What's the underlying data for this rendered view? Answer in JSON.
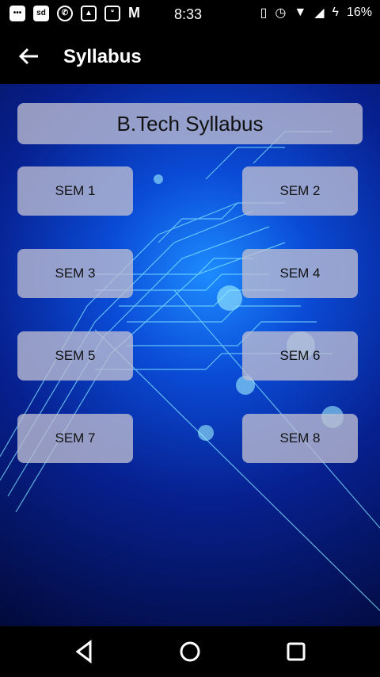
{
  "status_bar": {
    "time": "8:33",
    "battery_percent": "16%",
    "left_icons": [
      "message-icon",
      "sd-card-icon",
      "whatsapp-icon",
      "image-icon",
      "uc-browser-icon",
      "gmail-icon"
    ],
    "right_icons": [
      "vibrate-icon",
      "alarm-icon",
      "wifi-icon",
      "signal-icon",
      "battery-charging-icon"
    ]
  },
  "app_bar": {
    "title": "Syllabus",
    "back_icon": "arrow-left-icon"
  },
  "main": {
    "header": "B.Tech Syllabus",
    "semesters": [
      "SEM 1",
      "SEM 2",
      "SEM 3",
      "SEM 4",
      "SEM 5",
      "SEM 6",
      "SEM 7",
      "SEM 8"
    ]
  },
  "nav_bar": {
    "icons": [
      "back-triangle-icon",
      "home-circle-icon",
      "recents-square-icon"
    ]
  },
  "colors": {
    "background_top": "#1d8cff",
    "background_bottom": "#020a3a",
    "button_fill": "#bebed2",
    "bars": "#000000"
  }
}
